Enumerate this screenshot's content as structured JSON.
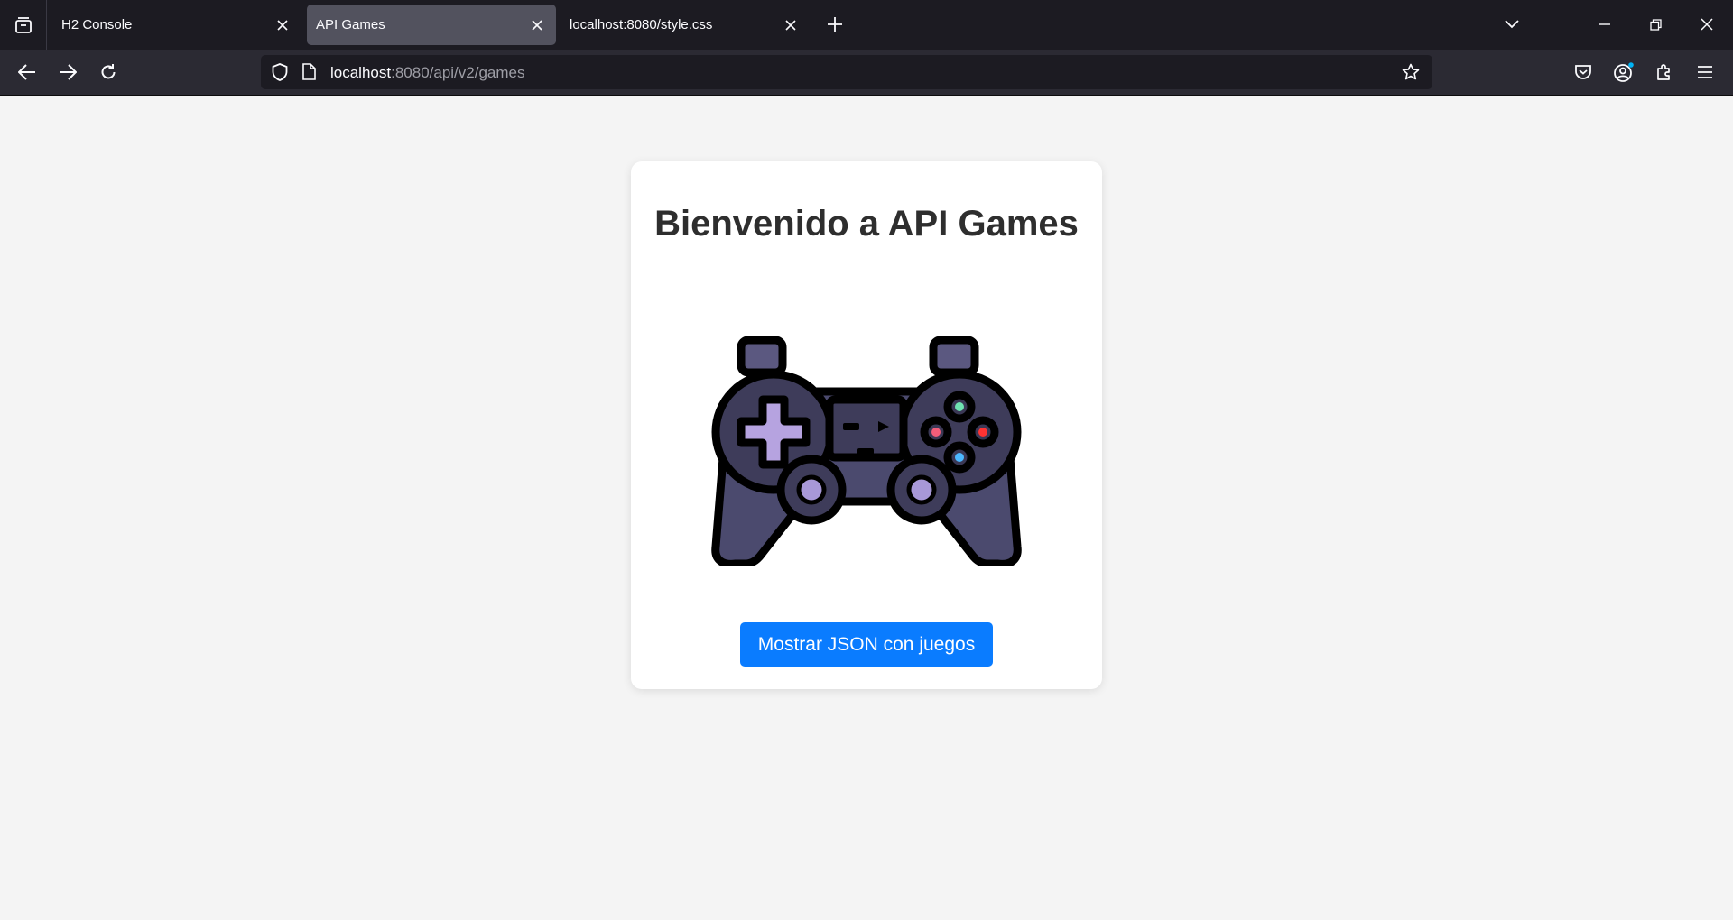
{
  "browser": {
    "tabs": [
      {
        "label": "H2 Console",
        "active": false
      },
      {
        "label": "API Games",
        "active": true
      },
      {
        "label": "localhost:8080/style.css",
        "active": false
      }
    ],
    "url": {
      "host": "localhost",
      "path": ":8080/api/v2/games"
    }
  },
  "page": {
    "heading": "Bienvenido a API Games",
    "image": "gamepad-illustration",
    "button_label": "Mostrar JSON con juegos",
    "colors": {
      "background": "#f4f4f4",
      "card": "#ffffff",
      "button": "#0a7cff"
    }
  },
  "icons": [
    "tab-list-icon",
    "close-icon",
    "plus-icon",
    "chevron-down-icon",
    "minimize-icon",
    "restore-icon",
    "back-icon",
    "forward-icon",
    "reload-icon",
    "shield-icon",
    "page-icon",
    "star-icon",
    "pocket-icon",
    "account-icon",
    "extensions-icon",
    "menu-icon"
  ]
}
